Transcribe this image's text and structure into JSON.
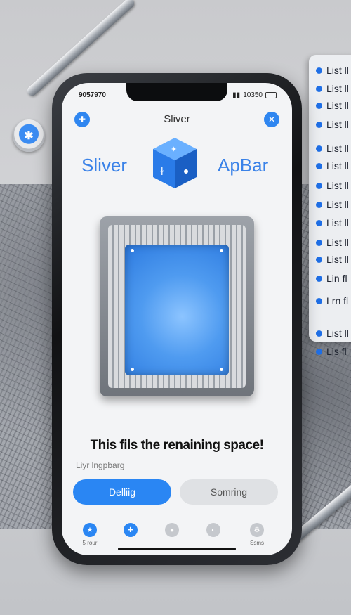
{
  "status": {
    "time": "9057970",
    "right_text": "10350"
  },
  "nav": {
    "title": "Sliver",
    "left_icon": "plus-icon",
    "right_icon": "close-icon"
  },
  "appbar": {
    "left_text": "Sliver",
    "right_text": "ApBar"
  },
  "main": {
    "fill_text": "This fils the renaining space!",
    "sub_label": "Liyr lngpbarg",
    "primary_button": "Delliig",
    "secondary_button": "Somring"
  },
  "tabs": [
    {
      "label": "5 rour",
      "icon": "star-icon",
      "active": true
    },
    {
      "label": "",
      "icon": "plus-icon",
      "active": true
    },
    {
      "label": "",
      "icon": "person-icon",
      "active": false
    },
    {
      "label": "",
      "icon": "circle-icon",
      "active": false
    },
    {
      "label": "Ssms",
      "icon": "gear-icon",
      "active": false
    }
  ],
  "side_list": [
    "List ll",
    "List ll",
    "List ll",
    "List ll",
    "List ll",
    "List ll",
    "List ll",
    "List ll",
    "List ll",
    "List ll",
    "List ll",
    "Lin fl",
    "Lrn fl",
    "List ll",
    "Lis fl"
  ],
  "colors": {
    "accent": "#2a86f3",
    "screen_bg": "#f3f4f6",
    "secondary_btn": "#dfe1e4"
  }
}
